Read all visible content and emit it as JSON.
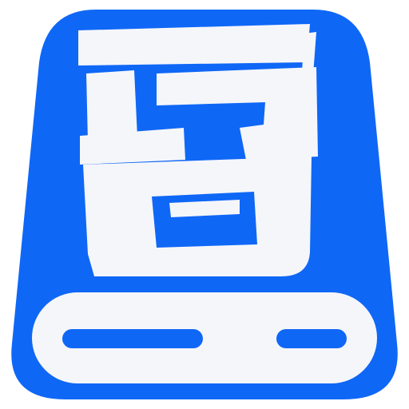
{
  "app_icon": {
    "glyph": "吾",
    "icon_name": "drive-icon-with-wu-glyph",
    "colors": {
      "primary_blue": "#0f67f6",
      "glyph_fill": "#f5f6fa",
      "tray_fill": "#f5f6fa",
      "background": "#ffffff"
    }
  }
}
